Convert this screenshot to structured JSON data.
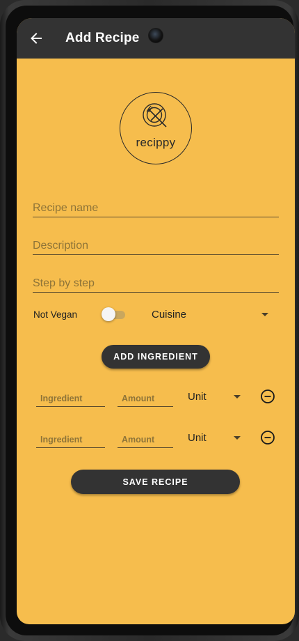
{
  "app_bar": {
    "title": "Add Recipe",
    "back_icon": "arrow-left-icon"
  },
  "logo": {
    "text": "recippy",
    "icon": "plate-fork-icon"
  },
  "form": {
    "recipe_name": {
      "value": "",
      "placeholder": "Recipe name"
    },
    "description": {
      "value": "",
      "placeholder": "Description"
    },
    "steps": {
      "value": "",
      "placeholder": "Step by step"
    },
    "vegan": {
      "label": "Not Vegan",
      "enabled": false
    },
    "cuisine": {
      "selected": "Cuisine"
    }
  },
  "buttons": {
    "add_ingredient": "ADD INGREDIENT",
    "save_recipe": "SAVE RECIPE"
  },
  "ingredients": [
    {
      "ingredient_placeholder": "Ingredient",
      "amount_placeholder": "Amount",
      "unit": "Unit",
      "remove_icon": "minus-circle-icon"
    },
    {
      "ingredient_placeholder": "Ingredient",
      "amount_placeholder": "Amount",
      "unit": "Unit",
      "remove_icon": "minus-circle-icon"
    }
  ],
  "colors": {
    "background": "#f6bd4d",
    "app_bar": "#333333",
    "button": "#333333",
    "placeholder": "#8e7438"
  }
}
